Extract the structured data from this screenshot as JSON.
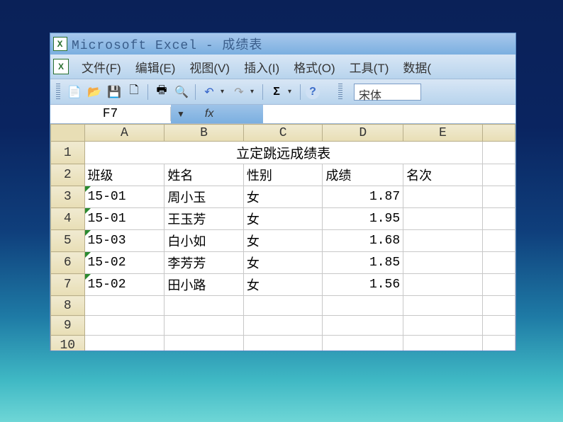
{
  "title": "Microsoft Excel - 成绩表",
  "menu": {
    "file": "文件(F)",
    "edit": "编辑(E)",
    "view": "视图(V)",
    "insert": "插入(I)",
    "format": "格式(O)",
    "tools": "工具(T)",
    "data": "数据("
  },
  "font_name": "宋体",
  "name_box": "F7",
  "fx_label": "fx",
  "columns": [
    "A",
    "B",
    "C",
    "D",
    "E"
  ],
  "row_numbers": [
    "1",
    "2",
    "3",
    "4",
    "5",
    "6",
    "7",
    "8",
    "9",
    "10"
  ],
  "merged_title": "立定跳远成绩表",
  "headers": {
    "class": "班级",
    "name": "姓名",
    "gender": "性别",
    "score": "成绩",
    "rank": "名次"
  },
  "rows": [
    {
      "class": "15-01",
      "name": "周小玉",
      "gender": "女",
      "score": "1.87",
      "rank": ""
    },
    {
      "class": "15-01",
      "name": "王玉芳",
      "gender": "女",
      "score": "1.95",
      "rank": ""
    },
    {
      "class": "15-03",
      "name": "白小如",
      "gender": "女",
      "score": "1.68",
      "rank": ""
    },
    {
      "class": "15-02",
      "name": "李芳芳",
      "gender": "女",
      "score": "1.85",
      "rank": ""
    },
    {
      "class": "15-02",
      "name": "田小路",
      "gender": "女",
      "score": "1.56",
      "rank": ""
    }
  ]
}
